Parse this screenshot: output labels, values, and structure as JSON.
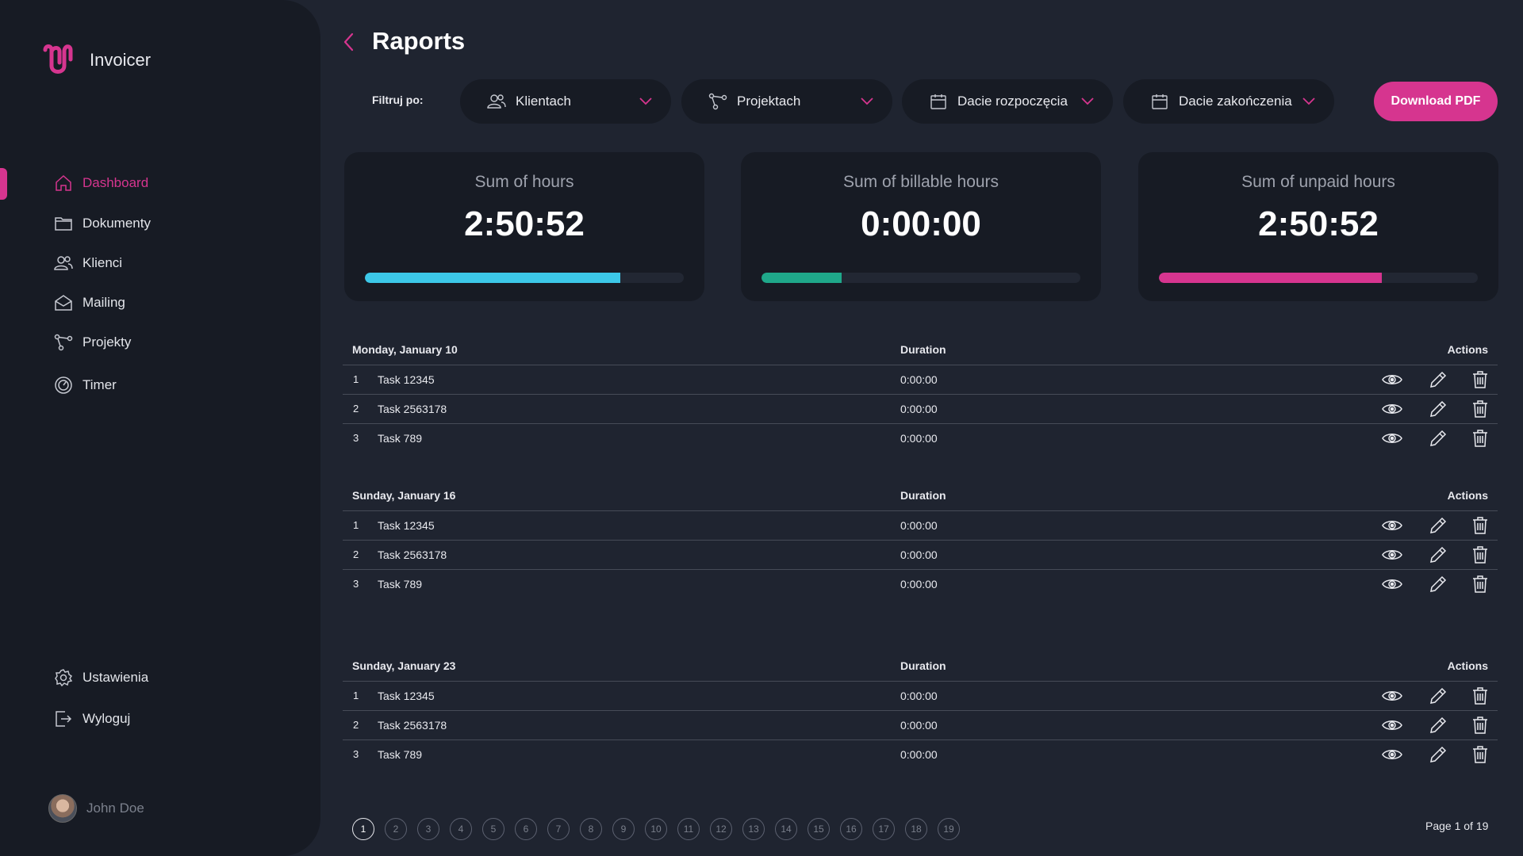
{
  "app": {
    "name": "Invoicer"
  },
  "colors": {
    "accent": "#d6358f",
    "hours": "#3cc8e8",
    "billable": "#1fa88a",
    "unpaid": "#d6358f"
  },
  "sidebar": {
    "items": [
      {
        "label": "Dashboard",
        "icon": "home-icon",
        "active": true
      },
      {
        "label": "Dokumenty",
        "icon": "folder-icon"
      },
      {
        "label": "Klienci",
        "icon": "users-icon"
      },
      {
        "label": "Mailing",
        "icon": "mail-icon"
      },
      {
        "label": "Projekty",
        "icon": "share-icon"
      },
      {
        "label": "Timer",
        "icon": "timer-icon"
      }
    ],
    "bottom": [
      {
        "label": "Ustawienia",
        "icon": "gear-icon"
      },
      {
        "label": "Wyloguj",
        "icon": "logout-icon"
      }
    ],
    "user": {
      "name": "John Doe"
    }
  },
  "header": {
    "title": "Raports"
  },
  "filters": {
    "label": "Filtruj po:",
    "items": [
      {
        "label": "Klientach",
        "icon": "users-icon"
      },
      {
        "label": "Projektach",
        "icon": "share-icon"
      },
      {
        "label": "Dacie rozpoczęcia",
        "icon": "calendar-icon"
      },
      {
        "label": "Dacie zakończenia",
        "icon": "calendar-icon"
      }
    ],
    "download_label": "Download PDF"
  },
  "stats": [
    {
      "label": "Sum of hours",
      "value": "2:50:52",
      "progress": 0.8
    },
    {
      "label": "Sum of billable hours",
      "value": "0:00:00",
      "progress": 0.25
    },
    {
      "label": "Sum of unpaid hours",
      "value": "2:50:52",
      "progress": 0.7
    }
  ],
  "tables": [
    {
      "date": "Monday, January 10",
      "duration_header": "Duration",
      "actions_header": "Actions",
      "rows": [
        {
          "num": "1",
          "task": "Task 12345",
          "duration": "0:00:00"
        },
        {
          "num": "2",
          "task": "Task 2563178",
          "duration": "0:00:00"
        },
        {
          "num": "3",
          "task": "Task 789",
          "duration": "0:00:00"
        }
      ]
    },
    {
      "date": "Sunday, January 16",
      "duration_header": "Duration",
      "actions_header": "Actions",
      "rows": [
        {
          "num": "1",
          "task": "Task 12345",
          "duration": "0:00:00"
        },
        {
          "num": "2",
          "task": "Task 2563178",
          "duration": "0:00:00"
        },
        {
          "num": "3",
          "task": "Task 789",
          "duration": "0:00:00"
        }
      ]
    },
    {
      "date": "Sunday, January 23",
      "duration_header": "Duration",
      "actions_header": "Actions",
      "rows": [
        {
          "num": "1",
          "task": "Task 12345",
          "duration": "0:00:00"
        },
        {
          "num": "2",
          "task": "Task 2563178",
          "duration": "0:00:00"
        },
        {
          "num": "3",
          "task": "Task 789",
          "duration": "0:00:00"
        }
      ]
    }
  ],
  "pagination": {
    "pages": [
      "1",
      "2",
      "3",
      "4",
      "5",
      "6",
      "7",
      "8",
      "9",
      "10",
      "11",
      "12",
      "13",
      "14",
      "15",
      "16",
      "17",
      "18",
      "19"
    ],
    "current": "1",
    "info": "Page 1 of 19"
  }
}
